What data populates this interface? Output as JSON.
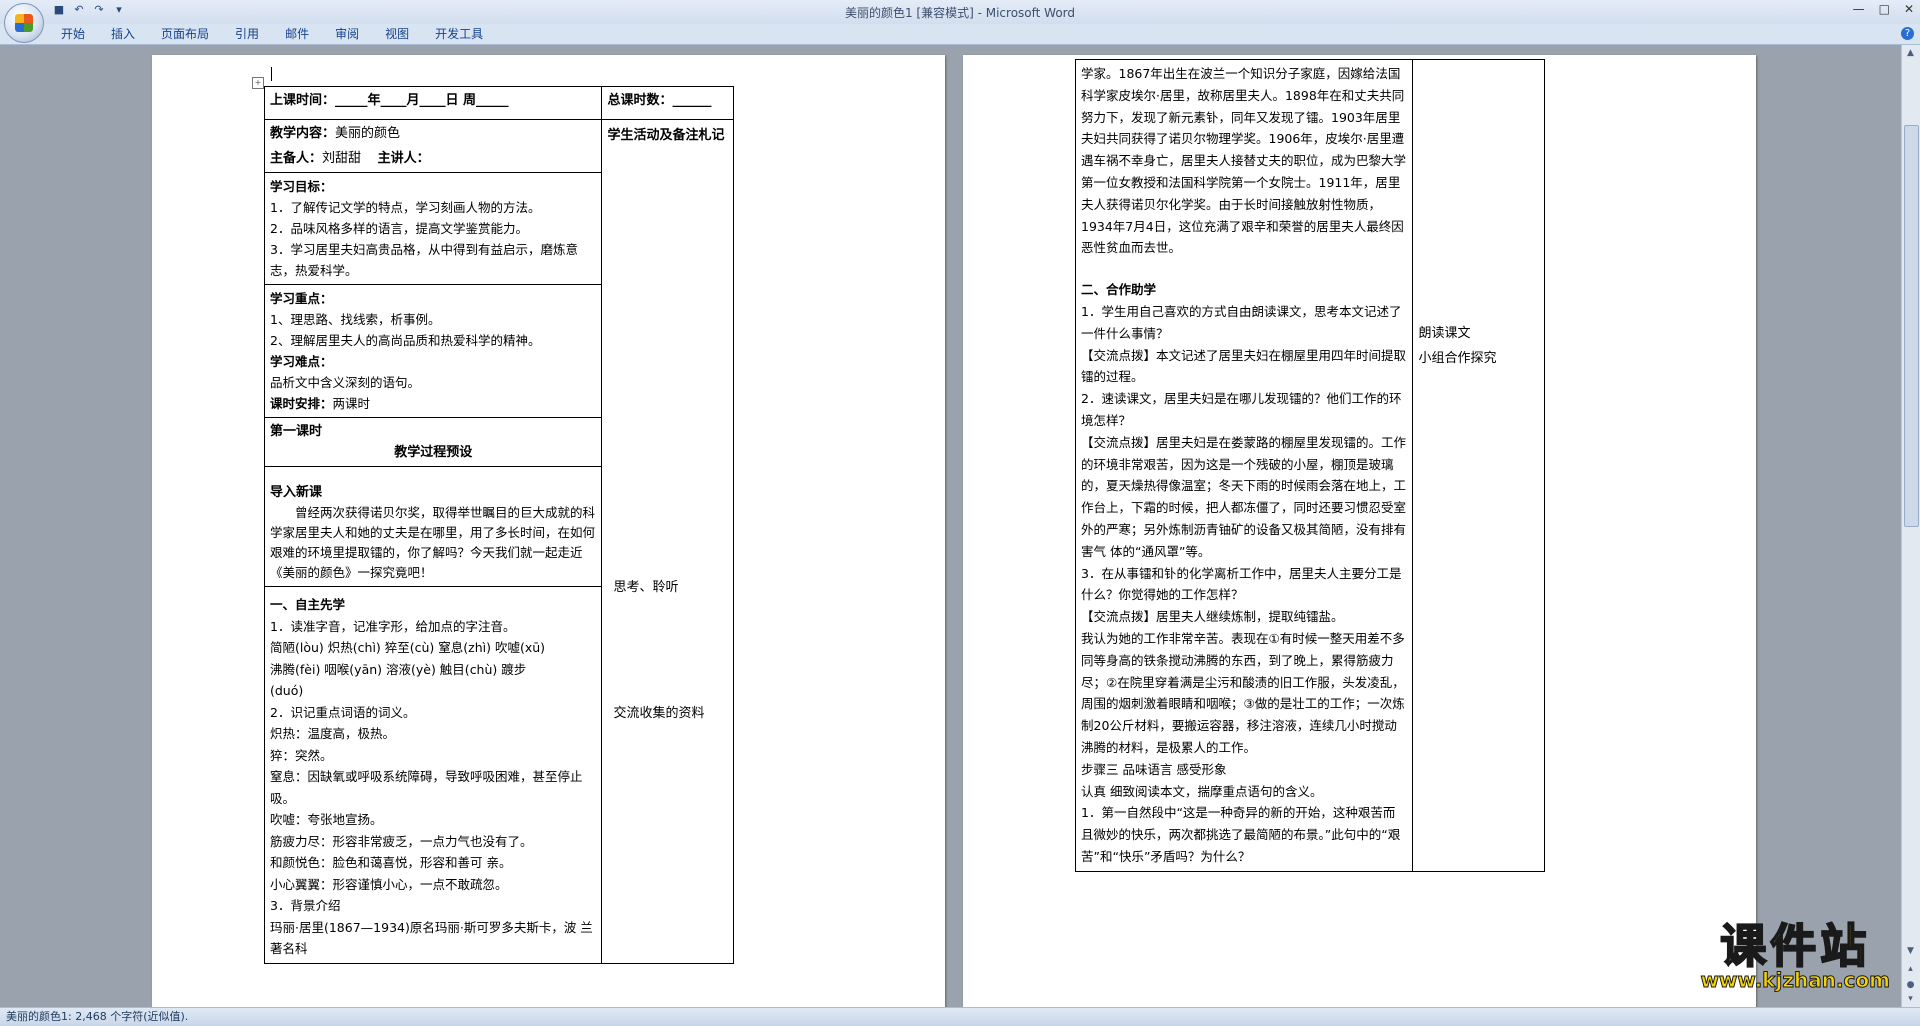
{
  "window": {
    "title": "美丽的颜色1 [兼容模式] - Microsoft Word"
  },
  "ribbon": {
    "tabs": [
      "开始",
      "插入",
      "页面布局",
      "引用",
      "邮件",
      "审阅",
      "视图",
      "开发工具"
    ]
  },
  "status": {
    "text": "美丽的颜色1: 2,468 个字符(近似值)."
  },
  "page1": {
    "row1": {
      "left": "上课时间：_____年____月____日  周_____",
      "right": "总课时数：______"
    },
    "row2": {
      "content_label": "教学内容：",
      "content_value": "美丽的颜色",
      "prep_label": "主备人：",
      "prep_value": "刘甜甜",
      "lecturer_label": "主讲人：",
      "right": "学生活动及备注札记"
    },
    "goals": {
      "title": "学习目标：",
      "items": [
        "1．了解传记文学的特点，学习刻画人物的方法。",
        "2．品味风格多样的语言，提高文学鉴赏能力。",
        "3．学习居里夫妇高贵品格，从中得到有益启示，磨炼意志，热爱科学。"
      ]
    },
    "focus": {
      "title": "学习重点：",
      "items": [
        "1、理思路、找线索，析事例。",
        "2、理解居里夫人的高尚品质和热爱科学的精神。"
      ],
      "difficulty_title": "学习难点：",
      "difficulty": "品析文中含义深刻的语句。",
      "time_label": "课时安排：",
      "time_value": "两课时"
    },
    "lesson": {
      "first": "第一课时",
      "heading": "教学过程预设"
    },
    "intro": {
      "title": "导入新课",
      "text": "曾经两次获得诺贝尔奖，取得举世瞩目的巨大成就的科学家居里夫人和她的丈夫是在哪里，用了多长时间，在如何艰难的环境里提取镭的，你了解吗？今天我们就一起走近《美丽的颜色》一探究竟吧！"
    },
    "self_study": {
      "title": "一、自主先学",
      "q1": "1．读准字音，记准字形，给加点的字注音。",
      "pinyin1": "简陋(lòu)  炽热(chì)  猝至(cù)  窒息(zhì)  吹嘘(xū)",
      "pinyin2": "沸腾(fèi)    咽喉(yān)    溶液(yè)    触目(chù)    踱步",
      "pinyin3": "(duó)",
      "q2": "2．识记重点词语的词义。",
      "defs": [
        "炽热：温度高，极热。",
        "猝：突然。",
        "窒息：因缺氧或呼吸系统障碍，导致呼吸困难，甚至停止吸。",
        "吹嘘：夸张地宣扬。",
        "筋疲力尽：形容非常疲乏，一点力气也没有了。",
        "和颜悦色：脸色和蔼喜悦，形容和善可  亲。",
        "小心翼翼：形容谨慎小心，一点不敢疏忽。"
      ],
      "q3": "3．背景介绍",
      "bg": "玛丽·居里(1867—1934)原名玛丽·斯可罗多夫斯卡，波  兰著名科"
    },
    "right_notes": {
      "think": "思考、聆听",
      "share": "交流收集的资料"
    }
  },
  "page2": {
    "bio": "学家。1867年出生在波兰一个知识分子家庭，因嫁给法国科学家皮埃尔·居里，故称居里夫人。1898年在和丈夫共同努力下，发现了新元素钋，同年又发现了镭。1903年居里夫妇共同获得了诺贝尔物理学奖。1906年，皮埃尔·居里遭遇车祸不幸身亡，居里夫人接替丈夫的职位，成为巴黎大学第一位女教授和法国科学院第一个女院士。1911年，居里夫人获得诺贝尔化学奖。由于长时间接触放射性物质，1934年7月4日，这位充满了艰辛和荣誉的居里夫人最终因恶性贫血而去世。",
    "coop_title": "二、合作助学",
    "coop": [
      "1．学生用自己喜欢的方式自由朗读课文，思考本文记述了一件什么事情？",
      "【交流点拨】本文记述了居里夫妇在棚屋里用四年时间提取镭的过程。",
      "2．速读课文，居里夫妇是在哪儿发现镭的？他们工作的环境怎样？",
      "【交流点拨】居里夫妇是在娄蒙路的棚屋里发现镭的。工作的环境非常艰苦，因为这是一个残破的小屋，棚顶是玻璃的，夏天燥热得像温室；冬天下雨的时候雨会落在地上，工作台上，下霜的时候，把人都冻僵了，同时还要习惯忍受室外的严寒；另外炼制沥青铀矿的设备又极其简陋，没有排有害气  体的“通风罩”等。",
      "3．在从事镭和钋的化学离析工作中，居里夫人主要分工是什么？你觉得她的工作怎样？",
      "【交流点拨】居里夫人继续炼制，提取纯镭盐。",
      "我认为她的工作非常辛苦。表现在①有时候一整天用差不多同等身高的铁条搅动沸腾的东西，到了晚上，累得筋疲力尽；②在院里穿着满是尘污和酸渍的旧工作服，头发凌乱，周围的烟刺激着眼睛和咽喉；③做的是壮工的工作；一次炼制20公斤材料，要搬运容器，移注溶液，连续几小时搅动沸腾的材料，是极累人的工作。",
      "步骤三  品味语言  感受形象",
      "认真  细致阅读本文，揣摩重点语句的含义。",
      "1．第一自然段中“这是一种奇异的新的开始，这种艰苦而  且微妙的快乐，两次都挑选了最简陋的布景。”此句中的“艰苦”和“快乐”矛盾吗？为什么？"
    ],
    "right_notes": {
      "read": "朗读课文",
      "group": "小组合作探究"
    }
  },
  "watermark": {
    "big": "课件站",
    "url": "www.kjzhan.com"
  }
}
